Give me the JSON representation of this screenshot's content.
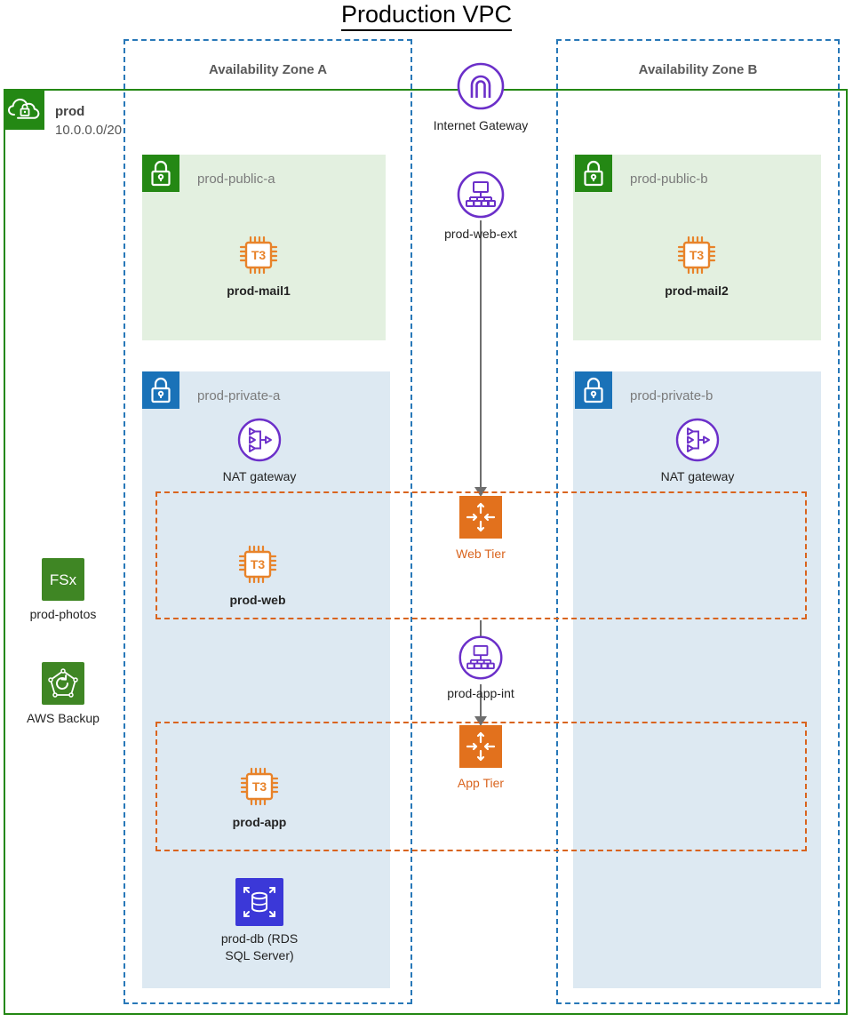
{
  "title": "Production VPC",
  "vpc": {
    "name": "prod",
    "cidr": "10.0.0.0/20",
    "icon": "vpc-cloud-lock-icon",
    "border_color": "#248814"
  },
  "availability_zones": [
    {
      "label": "Availability Zone A"
    },
    {
      "label": "Availability Zone B"
    }
  ],
  "subnets": [
    {
      "name": "prod-public-a",
      "type": "public",
      "icon": "lock-icon",
      "icon_color": "#248814",
      "fill": "#e3f0e0"
    },
    {
      "name": "prod-public-b",
      "type": "public",
      "icon": "lock-icon",
      "icon_color": "#248814",
      "fill": "#e3f0e0"
    },
    {
      "name": "prod-private-a",
      "type": "private",
      "icon": "lock-icon",
      "icon_color": "#1a72b8",
      "fill": "#dde9f2"
    },
    {
      "name": "prod-private-b",
      "type": "private",
      "icon": "lock-icon",
      "icon_color": "#1a72b8",
      "fill": "#dde9f2"
    }
  ],
  "nodes": {
    "internet_gateway": {
      "label": "Internet Gateway",
      "icon": "internet-gateway-icon",
      "color": "#6b2fc9"
    },
    "web_lb": {
      "label": "prod-web-ext",
      "icon": "load-balancer-icon",
      "color": "#6b2fc9"
    },
    "app_lb": {
      "label": "prod-app-int",
      "icon": "load-balancer-icon",
      "color": "#6b2fc9"
    },
    "nat_a": {
      "label": "NAT gateway",
      "icon": "nat-gateway-icon",
      "color": "#6b2fc9"
    },
    "nat_b": {
      "label": "NAT gateway",
      "icon": "nat-gateway-icon",
      "color": "#6b2fc9"
    },
    "mail1": {
      "label": "prod-mail1",
      "icon": "ec2-instance-icon",
      "badge": "T3",
      "color": "#e8832a"
    },
    "mail2": {
      "label": "prod-mail2",
      "icon": "ec2-instance-icon",
      "badge": "T3",
      "color": "#e8832a"
    },
    "web_ec2": {
      "label": "prod-web",
      "icon": "ec2-instance-icon",
      "badge": "T3",
      "color": "#e8832a"
    },
    "app_ec2": {
      "label": "prod-app",
      "icon": "ec2-instance-icon",
      "badge": "T3",
      "color": "#e8832a"
    },
    "db": {
      "label": "prod-db (RDS\nSQL Server)",
      "icon": "rds-database-icon",
      "color": "#3b38d8"
    },
    "web_tier": {
      "label": "Web Tier",
      "icon": "auto-scaling-group-icon",
      "color": "#d9641e"
    },
    "app_tier": {
      "label": "App Tier",
      "icon": "auto-scaling-group-icon",
      "color": "#d9641e"
    },
    "fsx": {
      "label": "prod-photos",
      "icon": "fsx-icon",
      "badge": "FSx",
      "color": "#3f8624"
    },
    "backup": {
      "label": "AWS Backup",
      "icon": "aws-backup-icon",
      "color": "#3f8624"
    }
  }
}
